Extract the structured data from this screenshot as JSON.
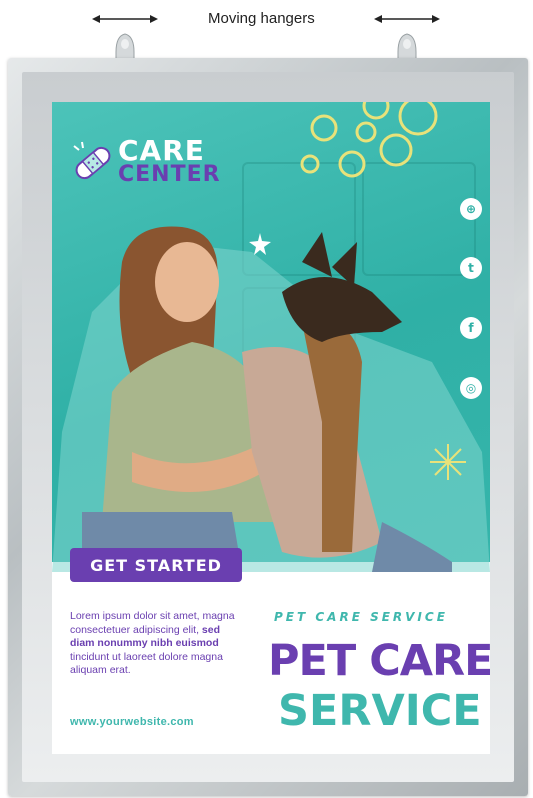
{
  "annotation": {
    "label": "Moving hangers"
  },
  "poster": {
    "logo": {
      "line1": "CARE",
      "line2": "CENTER",
      "icon": "bandage-icon"
    },
    "social_icons": [
      "link-icon",
      "twitter-icon",
      "facebook-icon",
      "instagram-icon"
    ],
    "social_glyphs": [
      "⊕",
      "t",
      "f",
      "◎"
    ],
    "button_label": "GET STARTED",
    "body_text_1": "Lorem ipsum dolor sit amet, magna consectetuer adipiscing elit,",
    "body_text_bold": "sed diam nonummy nibh euismod",
    "body_text_2": "tincidunt ut laoreet dolore magna aliquam erat.",
    "website": "www.yourwebsite.com",
    "tagline": "PET CARE SERVICE",
    "title_line1": "PET CARE",
    "title_line2": "SERVICE"
  },
  "colors": {
    "teal": "#3fb7ad",
    "purple": "#6a3fb0",
    "frame": "#c4c9cc"
  }
}
